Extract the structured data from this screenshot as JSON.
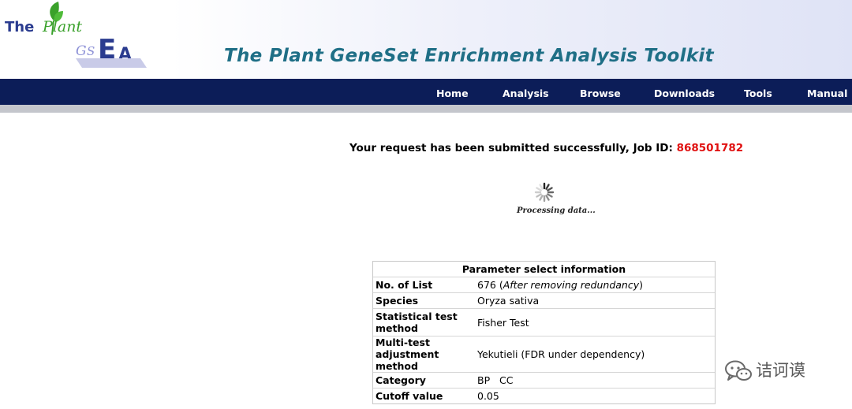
{
  "logo": {
    "line1": "The",
    "line2": "Plant",
    "line3": "GSEA"
  },
  "site_title": "The Plant GeneSet Enrichment Analysis Toolkit",
  "nav": [
    "Home",
    "Analysis",
    "Browse",
    "Downloads",
    "Tools",
    "Manual"
  ],
  "status": {
    "message": "Your request has been submitted successfully, Job ID: ",
    "job_id": "868501782",
    "processing": "Processing data..."
  },
  "params": {
    "title": "Parameter select information",
    "rows": [
      {
        "label": "No. of List",
        "value": "676",
        "note": "After removing redundancy"
      },
      {
        "label": "Species",
        "value": "Oryza sativa"
      },
      {
        "label": "Statistical test method",
        "value": "Fisher Test"
      },
      {
        "label": "Multi-test adjustment method",
        "value": "Yekutieli (FDR under dependency)"
      },
      {
        "label": "Category",
        "value": "BP   CC"
      },
      {
        "label": "Cutoff value",
        "value": "0.05"
      }
    ]
  },
  "watermark": "诘诃谟",
  "colors": {
    "nav_bg": "#0c1d58",
    "title": "#1f6f86",
    "job_id": "#e01010",
    "logo_green": "#3aa12b",
    "logo_blue": "#2a3b8f"
  }
}
